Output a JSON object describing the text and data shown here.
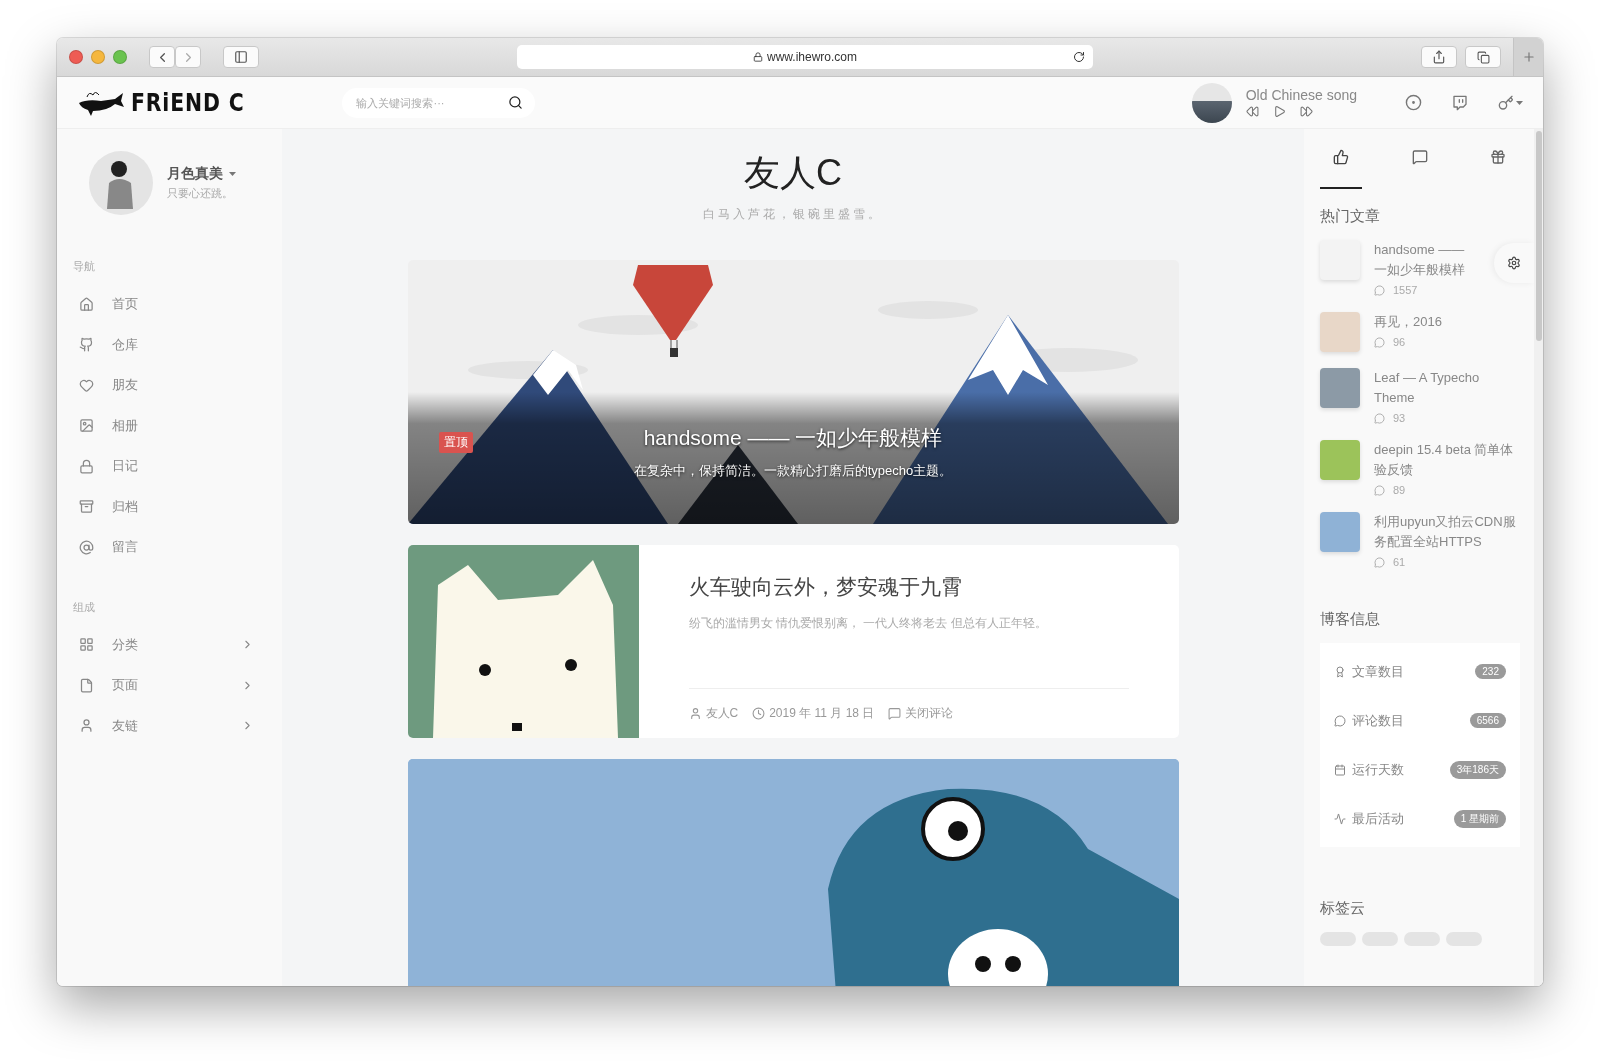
{
  "browser": {
    "url": "www.ihewro.com"
  },
  "header": {
    "logo_text": "FRiEND C",
    "search": {
      "placeholder": "输入关键词搜索···"
    },
    "player": {
      "song": "Old Chinese song"
    }
  },
  "profile": {
    "name": "月色真美",
    "motto": "只要心还跳。"
  },
  "nav_sections": [
    {
      "heading": "导航",
      "items": [
        {
          "label": "首页",
          "kind": "link"
        },
        {
          "label": "仓库",
          "kind": "link"
        },
        {
          "label": "朋友",
          "kind": "link"
        },
        {
          "label": "相册",
          "kind": "link"
        },
        {
          "label": "日记",
          "kind": "link"
        },
        {
          "label": "归档",
          "kind": "link"
        },
        {
          "label": "留言",
          "kind": "link"
        }
      ]
    },
    {
      "heading": "组成",
      "items": [
        {
          "label": "分类",
          "kind": "submenu"
        },
        {
          "label": "页面",
          "kind": "submenu"
        },
        {
          "label": "友链",
          "kind": "submenu"
        }
      ]
    }
  ],
  "site": {
    "title": "友人C",
    "subtitle": "白马入芦花，银碗里盛雪。"
  },
  "posts": [
    {
      "kind": "banner",
      "badge": "置顶",
      "title": "handsome —— 一如少年般模样",
      "excerpt": "在复杂中，保持简洁。一款精心打磨后的typecho主题。"
    },
    {
      "kind": "side_image",
      "title": "火车驶向云外，梦安魂于九霄",
      "excerpt": "纷飞的滥情男女 情仇爱恨别离， 一代人终将老去 但总有人正年轻。",
      "author": "友人C",
      "date": "2019 年 11 月 18 日",
      "comments": "关闭评论"
    },
    {
      "kind": "image_only"
    }
  ],
  "sidebar_tabs": [
    {
      "selected": true
    },
    {
      "selected": false
    },
    {
      "selected": false
    }
  ],
  "hot_posts": {
    "heading": "热门文章",
    "items": [
      {
        "title": "handsome —— 一如少年般模样",
        "comments": "1557"
      },
      {
        "title": "再见，2016",
        "comments": "96"
      },
      {
        "title": "Leaf — A Typecho Theme",
        "comments": "93"
      },
      {
        "title": "deepin 15.4 beta 简单体验反馈",
        "comments": "89"
      },
      {
        "title": "利用upyun又拍云CDN服务配置全站HTTPS",
        "comments": "61"
      }
    ]
  },
  "blog_info": {
    "heading": "博客信息",
    "items": [
      {
        "label": "文章数目",
        "value": "232"
      },
      {
        "label": "评论数目",
        "value": "6566"
      },
      {
        "label": "运行天数",
        "value": "3年186天"
      },
      {
        "label": "最后活动",
        "value": "1 星期前"
      }
    ]
  },
  "tag_cloud": {
    "heading": "标签云"
  }
}
